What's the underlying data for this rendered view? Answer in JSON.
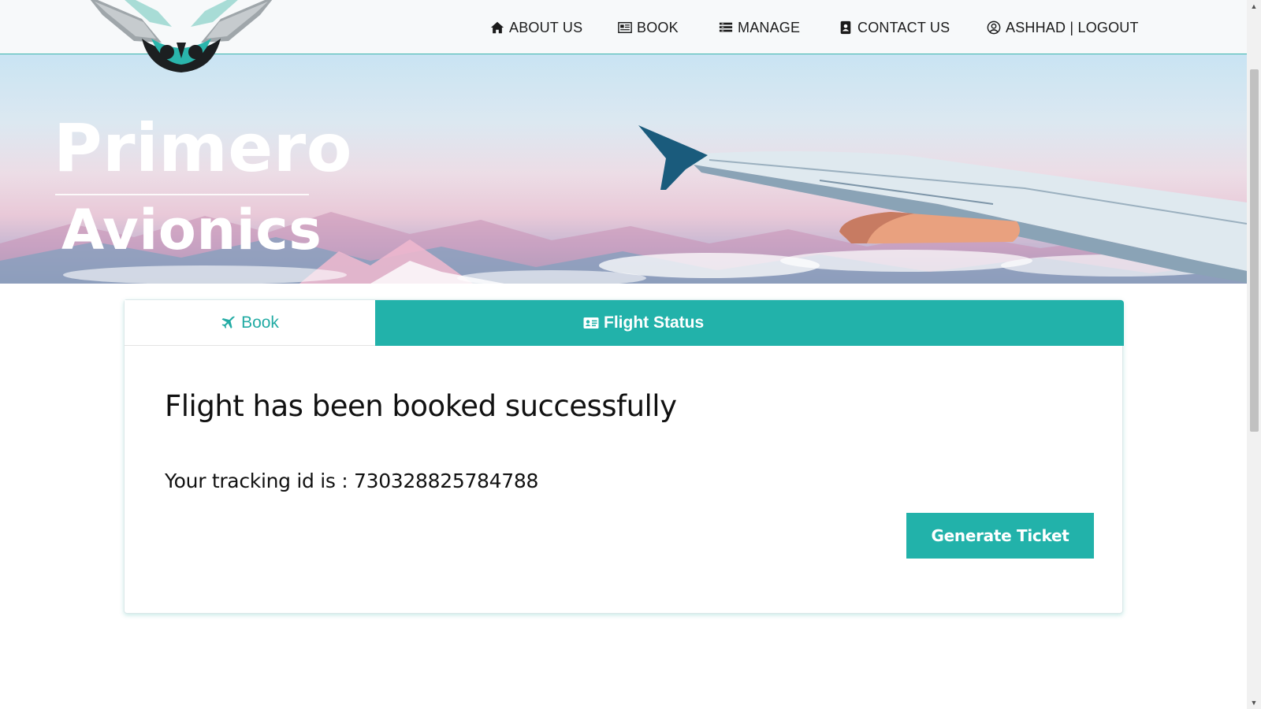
{
  "nav": {
    "about_label": "ABOUT US",
    "book_label": "BOOK",
    "manage_label": "MANAGE",
    "contact_label": "CONTACT US",
    "user_label": "ASHHAD | LOGOUT",
    "icons": [
      "home-icon",
      "newspaper-icon",
      "list-icon",
      "contact-card-icon",
      "user-circle-icon"
    ]
  },
  "hero": {
    "brand_line1": "Primero",
    "brand_line2": "Avionics"
  },
  "card": {
    "tabs": {
      "book_label": "Book",
      "status_label": "Flight Status"
    },
    "title": "Flight has been booked successfully",
    "tracking_text": "Your tracking id is : 730328825784788",
    "generate_button": "Generate Ticket"
  },
  "colors": {
    "accent": "#22b2aa",
    "text": "#111111",
    "nav_background": "#f7f9fa"
  }
}
